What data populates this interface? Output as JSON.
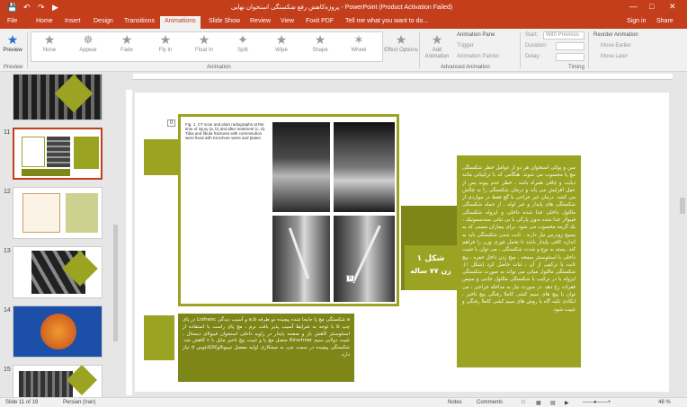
{
  "window": {
    "title": "پروژه‌کاهش رفع شکستگی استخوان نهایی - PowerPoint (Product Activation Failed)",
    "signin": "Sign in",
    "share": "Share"
  },
  "tabs": [
    "File",
    "Home",
    "Insert",
    "Design",
    "Transitions",
    "Animations",
    "Slide Show",
    "Review",
    "View",
    "Foxit PDF",
    "Tell me what you want to do..."
  ],
  "ribbon": {
    "preview": "Preview",
    "animations": [
      "None",
      "Appear",
      "Fade",
      "Fly In",
      "Float In",
      "Split",
      "Wipe",
      "Shape",
      "Wheel"
    ],
    "effect_options": "Effect Options",
    "add_animation": "Add Animation",
    "animation_pane": "Animation Pane",
    "trigger": "Trigger",
    "animation_painter": "Animation Painter",
    "start_label": "Start:",
    "start_value": "With Previous",
    "duration_label": "Duration:",
    "delay_label": "Delay:",
    "reorder": "Reorder Animation",
    "move_earlier": "Move Earlier",
    "move_later": "Move Later",
    "groups": {
      "preview": "Preview",
      "animation": "Animation",
      "advanced": "Advanced Animation",
      "timing": "Timing"
    }
  },
  "thumbnails": [
    {
      "num": ""
    },
    {
      "num": "11",
      "selected": true
    },
    {
      "num": "12"
    },
    {
      "num": "13"
    },
    {
      "num": "14"
    },
    {
      "num": "15"
    }
  ],
  "slide": {
    "badge_left": "0",
    "badge_photo": "0",
    "fig_caption": "Fig. 1. CT scan and plain radiographs at the time of injury (a, b) and after treatment (c, d). Tibia and fibula fractures with comminution were fixed with Kirschner wires and plates.",
    "heading_line1": "شکل ۱",
    "heading_line2": "زن ۷۷ ساله",
    "right_text": "سن و پوکی استخوان هر دو از عوامل خطر شکستگی مچ پا محسوب می شوند. هنگامی که با ترکیباتی مانند دیابت و چاقی همراه باشد ، خطر عدم پیوند پس از عمل افزایش می یابد و درمان شکستگی را به چالش می کشد. درمان غیر جراحی با گچ فقط در مواردی از شکستگی های پایدار و غیر لوله ، از جمله شکستگی مالئول داخلی جدا شده داخلی و ایزوله شکستگی فیبولار جدا شده بدون پارگی با بی ثباتی سندسموتیک ، یک گزینه محسوب می شود. برای بیماران مسنی که به پسیج زودرس نیاز دارند ، ثابت شدن شکستگی باید به اندازه کافی پایدار باشد تا تحمل فوری وزن را فراهم کند. بسته به نوع و شدت شکستگی ، می توان با تثبیت داخلی با استئوسنتز صفحه ، میخ زدن داخل حفره ، پیچ ثابت یا ترکیبی از آن ، ثبات حاصل کرد (شکل ۱). شکستگی مالئول میانی می تواند به صورت شکستگی ایزوله یا در ترکیب با شکستگی مالئول جانبی و سپس فقرات رخ دهد. در صورت نیاز به مداخله جراحی ، می توان با پیچ های سیم کشی کاملا رفتگی پیچ تاخیر ، ایکادی تکیه گاه یا روش های سیم کشی کاملا رفتگی و تثبیت شود.",
    "bottom_text": "a شکستگی مچ پا جابجا شده پیچیده دو طرفه a,b و آسیب دیدگی Lisfranc در پای چپ b با توجه به شرایط آسیب پذیر بافت نرم ، مچ پای راست با استفاده از استئوسنتز کاهش باز و صفحه پایدار در زاویه داخلی استخوان فیبولای دیستال ، تثبیت دولایی سیم Kirschner متصل مچ پا و تثبیت پیچ تاخیر مایل با c کاهش شد. شکستگی پیچیده در سمت چپ به میخکاری اولیه مفصل تیبیوتالوکالکانئوس d تیاز دارد."
  },
  "status": {
    "slide": "Slide 11 of 19",
    "lang": "Persian (Iran)",
    "notes": "Notes",
    "comments": "Comments",
    "zoom": "48 %"
  },
  "colors": {
    "brand": "#c43e1c",
    "olive": "#9aa322",
    "olive_dark": "#7d8617"
  }
}
